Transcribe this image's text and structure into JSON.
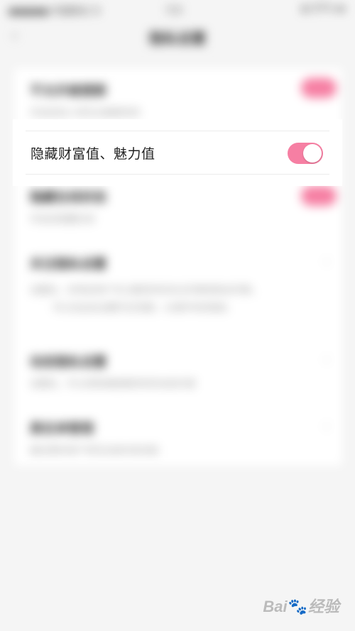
{
  "status_bar": {
    "carrier": "●●●●● 中国移动 令",
    "time": "下午",
    "battery": "◐ 87% ▬"
  },
  "nav": {
    "back_icon": "chevron-left-icon",
    "title": "隐私设置"
  },
  "focused_setting": {
    "label": "隐藏财富值、魅力值",
    "toggle_on": true,
    "toggle_color": "#f67fa3"
  },
  "background_rows": [
    {
      "title": "不允许被搜索",
      "subtitle": "开启后别人将无法搜索到你",
      "control": "switch"
    },
    {
      "title": "隐藏在线状态",
      "subtitle": "开启后隐藏在线",
      "control": "switch"
    },
    {
      "title": "关注隐私设置",
      "subtitle": "设置后，仅特定用户可以看到你的关注列表和粉丝列表，",
      "subtitle2": "可以在此处设置可见范围，以保护你的隐私",
      "control": "chevron"
    },
    {
      "title": "动态隐私设置",
      "subtitle": "设置后，可以控制谁能看到你的动态内容",
      "control": "chevron"
    },
    {
      "title": "黑名单管理",
      "subtitle": "被拉黑的用户将无法给你发消息",
      "control": "chevron"
    }
  ],
  "watermark": {
    "text_a": "Bai",
    "text_b": "经验"
  },
  "colors": {
    "accent": "#f67fa3",
    "background": "#f5f5f5",
    "card": "#ffffff"
  }
}
